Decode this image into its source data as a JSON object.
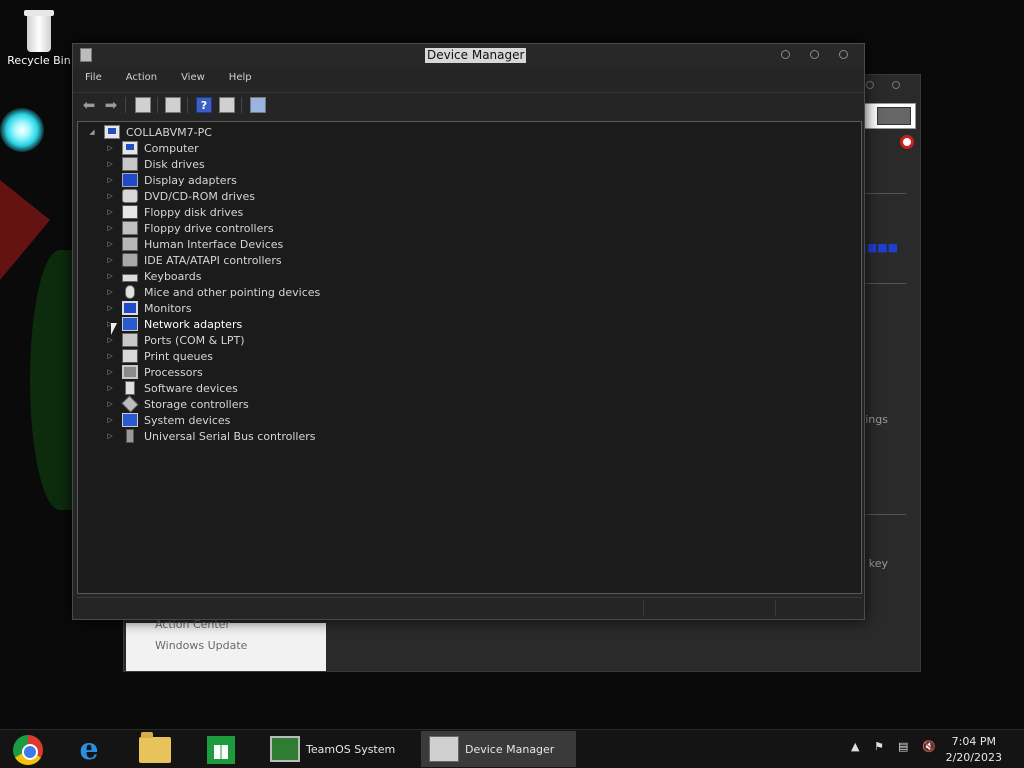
{
  "desktop": {
    "recycle_bin_label": "Recycle Bin"
  },
  "background_window": {
    "right_text_1": "tings",
    "right_text_2": "ct key",
    "side_items": [
      "Action Center",
      "Windows Update"
    ]
  },
  "device_manager": {
    "title": "Device Manager",
    "menu": [
      "File",
      "Action",
      "View",
      "Help"
    ],
    "toolbar_icons": [
      "back-arrow-icon",
      "forward-arrow-icon",
      "show-hide-console-tree-icon",
      "properties-icon",
      "help-icon",
      "export-list-icon",
      "scan-hardware-icon"
    ],
    "tree": {
      "root": "COLLABVM7-PC",
      "items": [
        {
          "label": "Computer",
          "icon": "computer-icon"
        },
        {
          "label": "Disk drives",
          "icon": "disk-drive-icon"
        },
        {
          "label": "Display adapters",
          "icon": "display-adapter-icon"
        },
        {
          "label": "DVD/CD-ROM drives",
          "icon": "dvd-drive-icon"
        },
        {
          "label": "Floppy disk drives",
          "icon": "floppy-disk-icon"
        },
        {
          "label": "Floppy drive controllers",
          "icon": "floppy-controller-icon"
        },
        {
          "label": "Human Interface Devices",
          "icon": "hid-icon"
        },
        {
          "label": "IDE ATA/ATAPI controllers",
          "icon": "ide-controller-icon"
        },
        {
          "label": "Keyboards",
          "icon": "keyboard-icon"
        },
        {
          "label": "Mice and other pointing devices",
          "icon": "mouse-icon"
        },
        {
          "label": "Monitors",
          "icon": "monitor-icon"
        },
        {
          "label": "Network adapters",
          "icon": "network-adapter-icon"
        },
        {
          "label": "Ports (COM & LPT)",
          "icon": "port-icon"
        },
        {
          "label": "Print queues",
          "icon": "printer-icon"
        },
        {
          "label": "Processors",
          "icon": "processor-icon"
        },
        {
          "label": "Software devices",
          "icon": "software-device-icon"
        },
        {
          "label": "Storage controllers",
          "icon": "storage-controller-icon"
        },
        {
          "label": "System devices",
          "icon": "system-device-icon"
        },
        {
          "label": "Universal Serial Bus controllers",
          "icon": "usb-icon"
        }
      ]
    }
  },
  "taskbar": {
    "pinned": [
      "chrome-icon",
      "internet-explorer-icon",
      "file-explorer-icon",
      "store-icon"
    ],
    "tasks": [
      {
        "label": "TeamOS System",
        "icon": "computer-monitor-icon"
      },
      {
        "label": "Device Manager",
        "icon": "device-manager-icon"
      }
    ],
    "clock": {
      "time": "7:04 PM",
      "date": "2/20/2023"
    }
  }
}
